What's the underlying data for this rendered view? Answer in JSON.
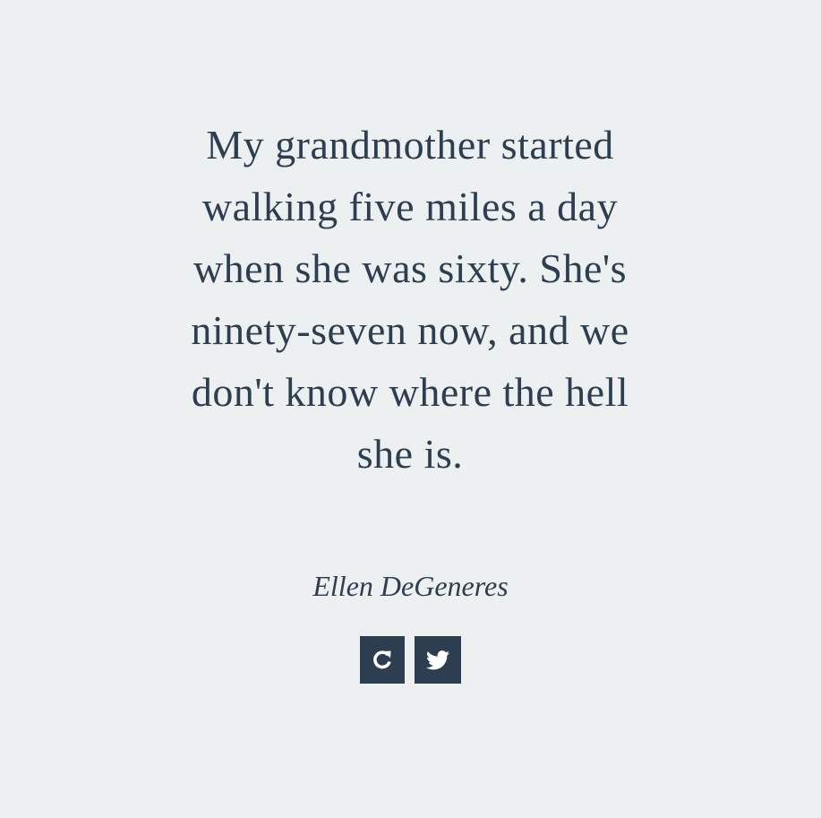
{
  "quote": {
    "text": "My grandmother started walking five miles a day when she was sixty. She's ninety-seven now, and we don't know where the hell she is.",
    "author": "Ellen DeGeneres"
  },
  "actions": {
    "new_quote_icon": "refresh-icon",
    "tweet_icon": "twitter-icon"
  },
  "colors": {
    "background": "#ecf0f1",
    "text": "#2c3e50",
    "button": "#2c3e50",
    "icon": "#ffffff"
  }
}
